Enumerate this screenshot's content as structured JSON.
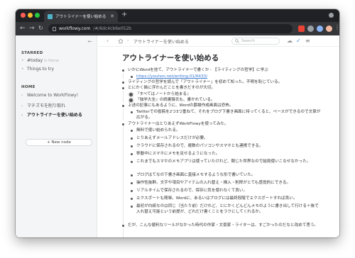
{
  "browser": {
    "tab_title": "アウトライナーを使い始める - Wo",
    "url_host": "workflowy.com",
    "url_path": "/#/6dc4cb6e052b"
  },
  "sidebar": {
    "starred_heading": "STARRED",
    "starred_items": [
      {
        "label": "#today",
        "muted": "in Home"
      },
      {
        "label": "Things to try",
        "muted": ""
      }
    ],
    "home_heading": "HOME",
    "home_items": [
      {
        "label": "Welcome to WorkFlowy!"
      },
      {
        "label": "マチズモを削り取れ"
      },
      {
        "label": "アウトライナーを使い始める"
      }
    ],
    "new_node_label": "+ New node"
  },
  "topbar": {
    "breadcrumb": "アウトライナーを使い始める",
    "search_placeholder": "Search"
  },
  "page": {
    "title": "アウトライナーを使い始める",
    "items": [
      {
        "text": "いかにWordを捨て、アウトライナーで書くか - 【ライティングの哲学】に学ぶ",
        "level": 0
      },
      {
        "text": "https://youhon.net/writing-01/6433/",
        "level": 1,
        "link": true
      },
      {
        "text": "ライティングの哲学を読んで「アウトライナー」を初めて知った。不明を恥じている。",
        "level": 0
      },
      {
        "text": "とにかく猫に浮かんだことを書きだすのが大切。",
        "level": 0
      },
      {
        "text": "『すべてはノートから始まる』",
        "level": 1,
        "ring": true
      },
      {
        "text": "『独学大全』の読書猿氏も、書かれている。",
        "level": 1,
        "ring": true
      },
      {
        "text": "上述の記事にもあるように、Wordの罫線作成画面は恐怖。",
        "level": 0
      },
      {
        "text": "Twitterでの投稿を2つ3つ重ねて、それをブログ下書き画面に持ってくると、ベースができるので文章が広がる。",
        "level": 1
      },
      {
        "text": "アウトライナーはとりあえずWorkFlowyを使ってみた。",
        "level": 0
      },
      {
        "text": "無料で使い始められる。",
        "level": 1
      },
      {
        "text": "とりあえずメールアドレスだけが必要。",
        "level": 1
      },
      {
        "text": "クラウドに保存されるので、複数のパソコンやスマホとも連携できる。",
        "level": 1
      },
      {
        "text": "移動中にスマホにメモを足せるようになった。",
        "level": 1
      },
      {
        "text": "これまでもスマホのメモアプリは使っていたけれど、閉じた世界なので結局使いこなせなかった。",
        "level": 1
      },
      {
        "text": "ブログはてなの下書き画面に直接メモするような形で書いていた。",
        "level": 1
      },
      {
        "text": "操作性抜群。文字や項目やアイテムの入れ替え・挿入・削除がとても感覚的にできる。",
        "level": 1
      },
      {
        "text": "リアルタイムで保存されるので、保存に気を使わなくて良い。",
        "level": 1
      },
      {
        "text": "エクスポートも簡単。Wordに、あるいはブログには最終段階でエクスポートすれば良い。",
        "level": 1
      },
      {
        "text": "最初が白紙なのは同じ（当たり前）だけれど、とにかくどんどんメモのように書き出して行ける＋後で入れ替え可能という前提が、どれだけ書くことをラクにしてくれるか。",
        "level": 1
      },
      {
        "text": "だが、こんな便利なツールがなかった時代の作家・文豪家・ライターは、すごかったのだなと改めて思う。",
        "level": 0
      }
    ]
  }
}
